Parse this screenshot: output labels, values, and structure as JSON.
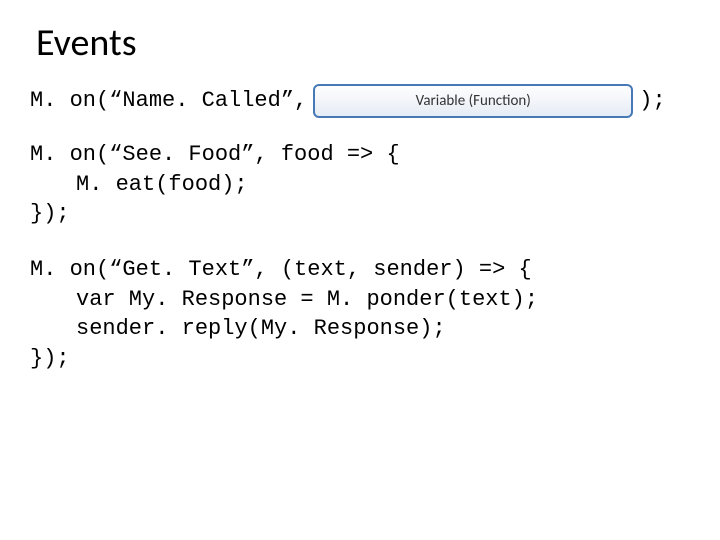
{
  "title": "Events",
  "line1": {
    "left": "M. on(“Name. Called”,",
    "badge": "Variable (Function)",
    "right": ");"
  },
  "block2": {
    "l1": "M. on(“See. Food”, food => {",
    "l2": "M. eat(food);",
    "l3": "});"
  },
  "block3": {
    "l1": "M. on(“Get. Text”, (text, sender) => {",
    "l2": "var My. Response = M. ponder(text);",
    "l3": "sender. reply(My. Response);",
    "l4": "});"
  }
}
